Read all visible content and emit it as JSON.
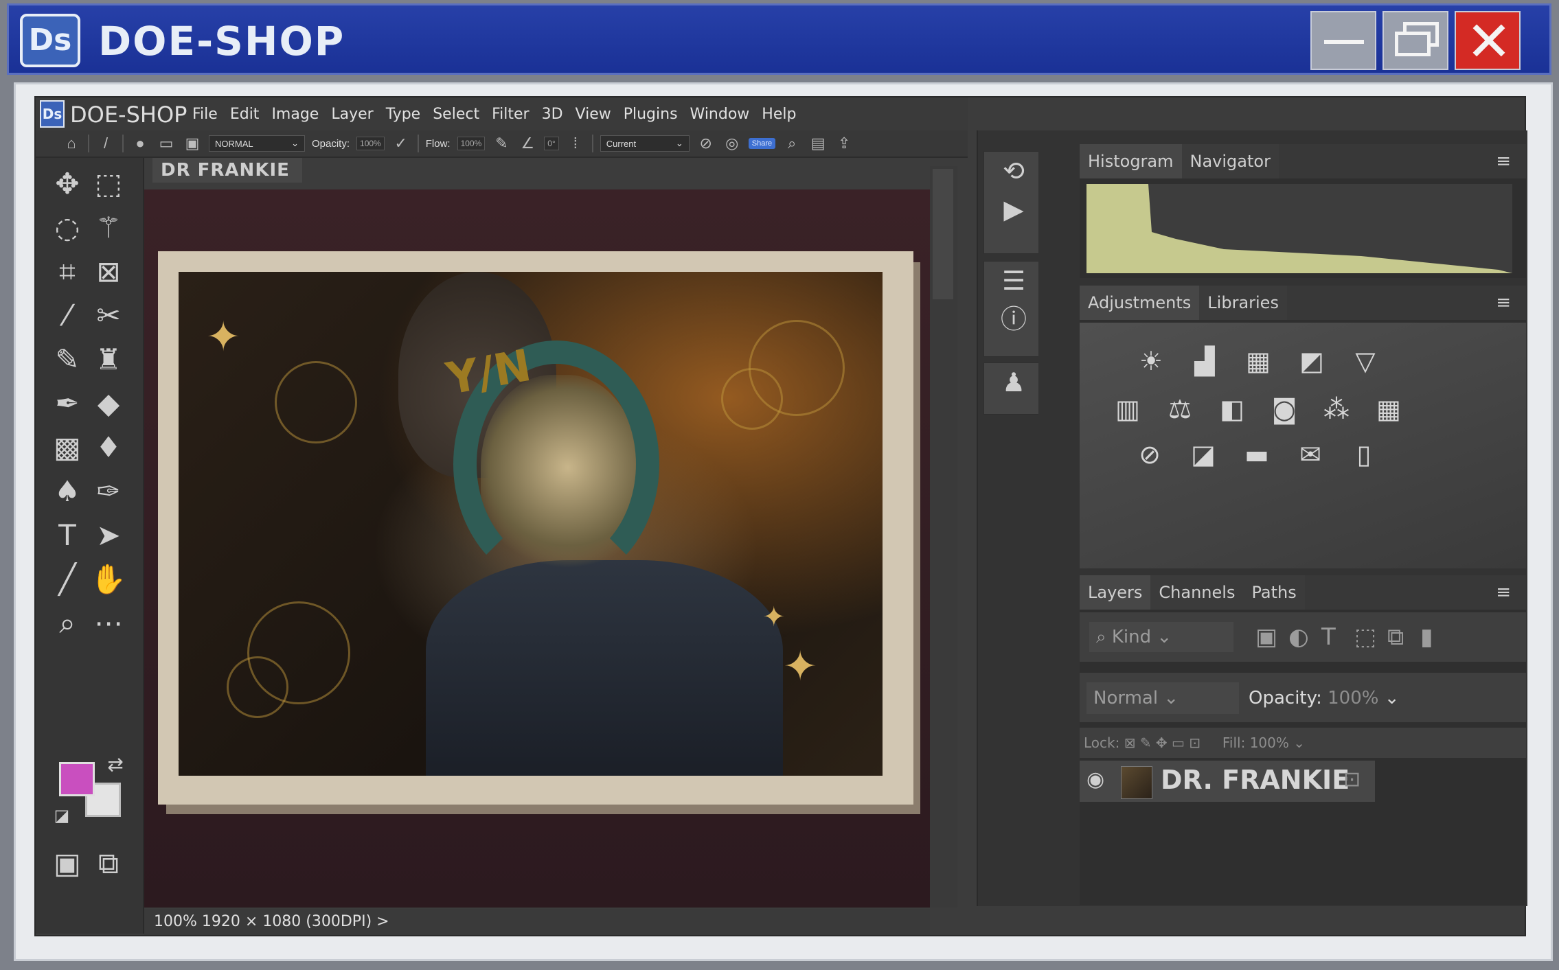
{
  "os": {
    "logo": "Ds",
    "title": "DOE-SHOP",
    "min_icon": "minimize-icon",
    "max_icon": "restore-icon",
    "close_icon": "close-icon",
    "close_glyph": "✕",
    "colors": {
      "titlebar": "#2740a8",
      "close": "#d42a24"
    }
  },
  "app": {
    "logo": "Ds",
    "name": "DOE-SHOP",
    "menu": [
      "File",
      "Edit",
      "Image",
      "Layer",
      "Type",
      "Select",
      "Filter",
      "3D",
      "View",
      "Plugins",
      "Window",
      "Help"
    ]
  },
  "options": {
    "home_glyph": "⌂",
    "brush_glyph": "/",
    "blend_mode": "NORMAL",
    "opacity_label": "Opacity:",
    "opacity_value": "100%",
    "flow_label": "Flow:",
    "flow_value": "100%",
    "angle_value": "0°",
    "sample": "Current",
    "share": "Share"
  },
  "document": {
    "tab_title": "DR FRANKIE",
    "artwork_text": "Y/N"
  },
  "status": {
    "zoom": "100%",
    "size": "1920 × 1080 (300DPI)",
    "arrow": ">"
  },
  "panels": {
    "histogram_tab": "Histogram",
    "navigator_tab": "Navigator",
    "adjustments_tab": "Adjustments",
    "libraries_tab": "Libraries",
    "layers_tab": "Layers",
    "channels_tab": "Channels",
    "paths_tab": "Paths",
    "menu_glyph": "≡"
  },
  "layers": {
    "kind": "Kind",
    "blend": "Normal",
    "opacity_label": "Opacity:",
    "opacity_value": "100%",
    "lock_label": "Lock:",
    "fill_label": "Fill:",
    "fill_value": "100%",
    "layer_name": "DR. FRANKIE"
  },
  "colors": {
    "foreground": "#c94fbf",
    "background": "#e4e4e4"
  }
}
